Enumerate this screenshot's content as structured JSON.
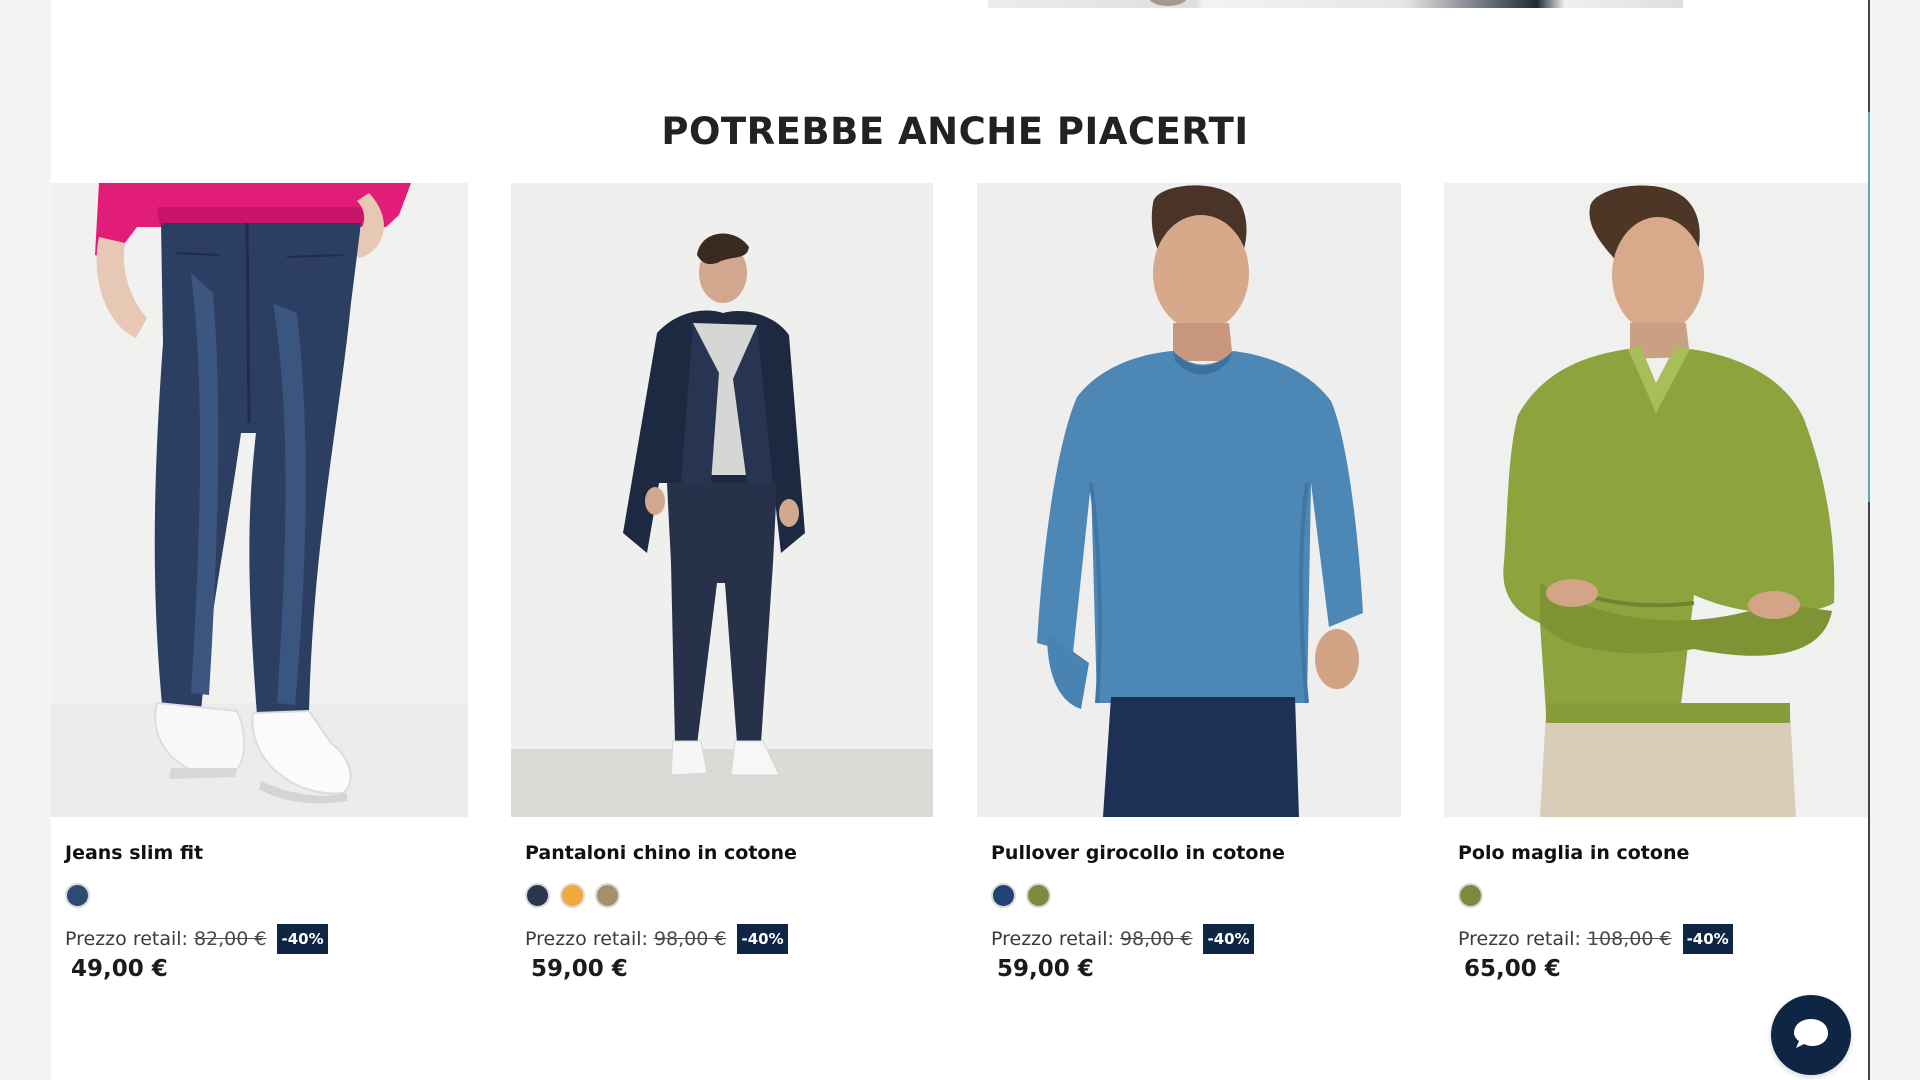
{
  "section": {
    "title": "POTREBBE ANCHE PIACERTI"
  },
  "price_label": "Prezzo retail:",
  "products": [
    {
      "name": "Jeans slim fit",
      "image_alt": "Jeans slim fit",
      "swatches": [
        "#2d4a73"
      ],
      "old_price": "82,00 €",
      "discount": "-40%",
      "price": "49,00 €"
    },
    {
      "name": "Pantaloni chino in cotone",
      "image_alt": "Pantaloni chino in cotone",
      "swatches": [
        "#2b3650",
        "#f2a93b",
        "#a79068"
      ],
      "old_price": "98,00 €",
      "discount": "-40%",
      "price": "59,00 €"
    },
    {
      "name": "Pullover girocollo in cotone",
      "image_alt": "Pullover girocollo in cotone",
      "swatches": [
        "#234372",
        "#7f8a3a"
      ],
      "old_price": "98,00 €",
      "discount": "-40%",
      "price": "59,00 €"
    },
    {
      "name": "Polo maglia in cotone",
      "image_alt": "Polo maglia in cotone",
      "swatches": [
        "#7c8a3c"
      ],
      "old_price": "108,00 €",
      "discount": "-40%",
      "price": "65,00 €"
    }
  ],
  "chat": {
    "icon": "chat-bubble-icon"
  },
  "colors": {
    "badge": "#0e2544",
    "chat_button": "#0e2544"
  }
}
